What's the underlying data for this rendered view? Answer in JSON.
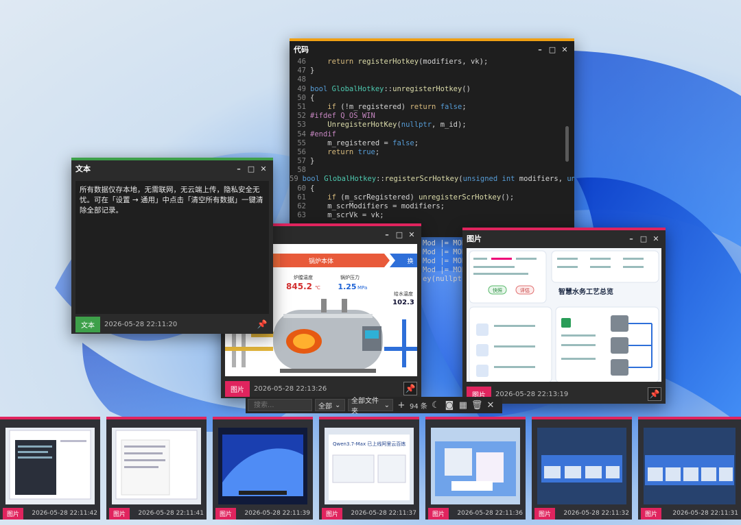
{
  "code_window": {
    "title": "代码",
    "lines": [
      {
        "n": "46",
        "t": "    return registerHotkey(modifiers, vk);"
      },
      {
        "n": "47",
        "t": "}"
      },
      {
        "n": "48",
        "t": ""
      },
      {
        "n": "49",
        "t": "bool GlobalHotkey::unregisterHotkey()"
      },
      {
        "n": "50",
        "t": "{"
      },
      {
        "n": "51",
        "t": "    if (!m_registered) return false;"
      },
      {
        "n": "52",
        "t": "#ifdef Q_OS_WIN"
      },
      {
        "n": "53",
        "t": "    UnregisterHotKey(nullptr, m_id);"
      },
      {
        "n": "54",
        "t": "#endif"
      },
      {
        "n": "55",
        "t": "    m_registered = false;"
      },
      {
        "n": "56",
        "t": "    return true;"
      },
      {
        "n": "57",
        "t": "}"
      },
      {
        "n": "58",
        "t": ""
      },
      {
        "n": "59",
        "t": "bool GlobalHotkey::registerScrHotkey(unsigned int modifiers, unsigned int vk)"
      },
      {
        "n": "60",
        "t": "{"
      },
      {
        "n": "61",
        "t": "    if (m_scrRegistered) unregisterScrHotkey();"
      },
      {
        "n": "62",
        "t": "    m_scrModifiers = modifiers;"
      },
      {
        "n": "63",
        "t": "    m_scrVk = vk;"
      }
    ],
    "fragments": [
      "Mod |= MOD",
      "Mod |= MOD",
      "Mod |= MOD",
      "Mod |= MOD",
      "ey(nullptr, m"
    ]
  },
  "text_window": {
    "title": "文本",
    "content": "所有数据仅存本地，无需联网，无云端上传，隐私安全无忧。可在「设置 → 通用」中点击「清空所有数据」一键清除全部记录。",
    "tag": "文本",
    "time": "2026-05-28 22:11:20"
  },
  "image_window_1": {
    "tag": "图片",
    "time": "2026-05-28 22:13:26",
    "img_banner": "锅炉本体",
    "img_banner_right": "换",
    "metrics": [
      {
        "label": "炉膛温度",
        "value": "845.2",
        "unit": "℃"
      },
      {
        "label": "锅炉压力",
        "value": "1.25",
        "unit": "MPa"
      },
      {
        "label": "给水温度",
        "value": "102.3",
        "unit": ""
      }
    ]
  },
  "image_window_2": {
    "title": "图片",
    "tag": "图片",
    "time": "2026-05-28 22:13:19",
    "img_heading": "智慧水务工艺总览",
    "img_btn_1": "快照",
    "img_btn_2": "评估"
  },
  "window_controls": {
    "minimize": "–",
    "maximize": "□",
    "close": "✕"
  },
  "toolbar": {
    "search_placeholder": "搜索...",
    "filter_type": "全部",
    "filter_folder": "全部文件夹",
    "count": "94 条"
  },
  "history": [
    {
      "tag": "图片",
      "time": "2026-05-28 22:11:42"
    },
    {
      "tag": "图片",
      "time": "2026-05-28 22:11:41"
    },
    {
      "tag": "图片",
      "time": "2026-05-28 22:11:39"
    },
    {
      "tag": "图片",
      "time": "2026-05-28 22:11:37",
      "thumb_text": "Qwen3.7-Max 已上线阿里云百炼"
    },
    {
      "tag": "图片",
      "time": "2026-05-28 22:11:36"
    },
    {
      "tag": "图片",
      "time": "2026-05-28 22:11:32"
    },
    {
      "tag": "图片",
      "time": "2026-05-28 22:11:31"
    }
  ],
  "colors": {
    "code_accent": "#f0a013",
    "text_accent": "#3ea04a",
    "image_accent": "#e0245e"
  }
}
